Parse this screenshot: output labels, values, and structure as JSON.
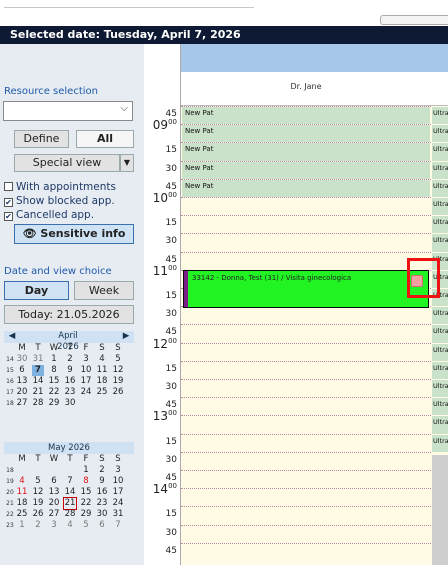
{
  "title": "Selected date:  Tuesday, April 7, 2026",
  "sidebar": {
    "resource_label": "Resource selection",
    "define": "Define",
    "all": "All",
    "special_view": "Special view",
    "options": [
      {
        "label": "With appointments",
        "checked": false
      },
      {
        "label": "Show blocked app.",
        "checked": true
      },
      {
        "label": "Cancelled app.",
        "checked": true
      }
    ],
    "sensitive": "Sensitive info",
    "date_label": "Date and view choice",
    "day": "Day",
    "week": "Week",
    "today": "Today: 21.05.2026"
  },
  "cal_april": {
    "month": "April 2026",
    "dow": [
      "M",
      "T",
      "W",
      "T",
      "F",
      "S",
      "S"
    ],
    "weeks": [
      {
        "wk": "14",
        "days": [
          "30",
          "31",
          "1",
          "2",
          "3",
          "4",
          "5"
        ]
      },
      {
        "wk": "15",
        "days": [
          "6",
          "7",
          "8",
          "9",
          "10",
          "11",
          "12"
        ]
      },
      {
        "wk": "16",
        "days": [
          "13",
          "14",
          "15",
          "16",
          "17",
          "18",
          "19"
        ]
      },
      {
        "wk": "17",
        "days": [
          "20",
          "21",
          "22",
          "23",
          "24",
          "25",
          "26"
        ]
      },
      {
        "wk": "18",
        "days": [
          "27",
          "28",
          "29",
          "30",
          "",
          "",
          ""
        ]
      }
    ]
  },
  "cal_may": {
    "month": "May 2026",
    "dow": [
      "M",
      "T",
      "W",
      "T",
      "F",
      "S",
      "S"
    ],
    "weeks": [
      {
        "wk": "18",
        "days": [
          "",
          "",
          "",
          "",
          "1",
          "2",
          "3"
        ]
      },
      {
        "wk": "19",
        "days": [
          "4",
          "5",
          "6",
          "7",
          "8",
          "9",
          "10"
        ]
      },
      {
        "wk": "20",
        "days": [
          "11",
          "12",
          "13",
          "14",
          "15",
          "16",
          "17"
        ]
      },
      {
        "wk": "21",
        "days": [
          "18",
          "19",
          "20",
          "21",
          "22",
          "23",
          "24"
        ]
      },
      {
        "wk": "22",
        "days": [
          "25",
          "26",
          "27",
          "28",
          "29",
          "30",
          "31"
        ]
      },
      {
        "wk": "23",
        "days": [
          "1",
          "2",
          "3",
          "4",
          "5",
          "6",
          "7"
        ]
      }
    ]
  },
  "colors": {
    "accent": "#0e1a33",
    "appointment": "#22f322",
    "blocked": "#c9e2c9"
  },
  "schedule": {
    "resource": "Dr. Jane",
    "new_pat": "New Pat",
    "ultra": "Ultra",
    "appointment": "33142 - Donna, Test (31) / Visita ginecologica",
    "times": [
      {
        "h": "",
        "m": "45"
      },
      {
        "h": "09",
        "m": "00"
      },
      {
        "h": "",
        "m": "15"
      },
      {
        "h": "",
        "m": "30"
      },
      {
        "h": "",
        "m": "45"
      },
      {
        "h": "10",
        "m": "00"
      },
      {
        "h": "",
        "m": "15"
      },
      {
        "h": "",
        "m": "30"
      },
      {
        "h": "",
        "m": "45"
      },
      {
        "h": "11",
        "m": "00"
      },
      {
        "h": "",
        "m": "15"
      },
      {
        "h": "",
        "m": "30"
      },
      {
        "h": "",
        "m": "45"
      },
      {
        "h": "12",
        "m": "00"
      },
      {
        "h": "",
        "m": "15"
      },
      {
        "h": "",
        "m": "30"
      },
      {
        "h": "",
        "m": "45"
      },
      {
        "h": "13",
        "m": "00"
      },
      {
        "h": "",
        "m": "15"
      },
      {
        "h": "",
        "m": "30"
      },
      {
        "h": "",
        "m": "45"
      },
      {
        "h": "14",
        "m": "00"
      },
      {
        "h": "",
        "m": "15"
      },
      {
        "h": "",
        "m": "30"
      },
      {
        "h": "",
        "m": "45"
      }
    ]
  }
}
